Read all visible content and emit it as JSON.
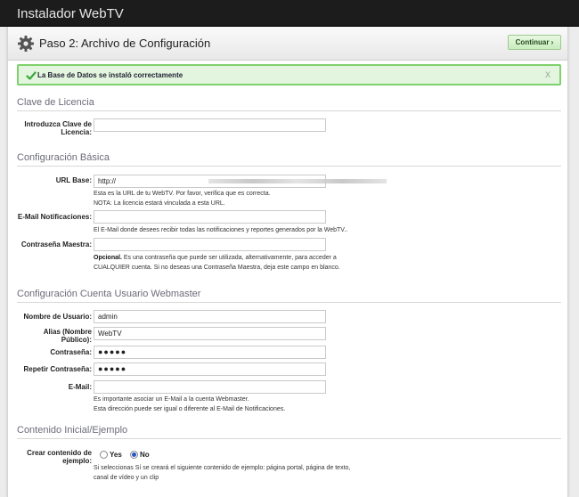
{
  "app": {
    "title": "Instalador WebTV"
  },
  "header": {
    "title": "Paso 2: Archivo de Configuración",
    "continue_label": "Continuar ›"
  },
  "alert": {
    "message": "La Base de Datos se instaló correctamente",
    "close": "X"
  },
  "license": {
    "section_title": "Clave de Licencia",
    "key_label": "Introduzca Clave de Licencia:",
    "key_value": ""
  },
  "basic": {
    "section_title": "Configuración Básica",
    "url_label": "URL Base:",
    "url_value": "http://",
    "url_help_1": "Esta es la URL de tu WebTV. Por favor, verifica que es correcta.",
    "url_help_2": "NOTA: La licencia estará vinculada a esta URL.",
    "email_label": "E-Mail Notificaciones:",
    "email_value": "",
    "email_help": "El E-Mail donde desees recibir todas las notificaciones y reportes generados por la WebTV..",
    "master_label": "Contraseña Maestra:",
    "master_value": "",
    "master_help_bold": "Opcional.",
    "master_help_1": " Es una contraseña que puede ser utilizada, alternativamente, para acceder a",
    "master_help_2": "CUALQUIER cuenta. Si no deseas una Contraseña Maestra, deja este campo en blanco."
  },
  "webmaster": {
    "section_title": "Configuración Cuenta Usuario Webmaster",
    "username_label": "Nombre de Usuario:",
    "username_value": "admin",
    "alias_label": "Alias (Nombre Público):",
    "alias_value": "WebTV",
    "password_label": "Contraseña:",
    "password_value": "●●●●●",
    "repeat_label": "Repetir Contraseña:",
    "repeat_value": "●●●●●",
    "email_label": "E-Mail:",
    "email_value": "",
    "email_help_1": "Es importante asociar un E-Mail a la cuenta Webmaster.",
    "email_help_2": "Esta dirección puede ser igual o diferente al E-Mail de Notificaciones."
  },
  "content": {
    "section_title": "Contenido Inicial/Ejemplo",
    "create_label": "Crear contenido de ejemplo:",
    "yes_label": "Yes",
    "no_label": "No",
    "selected": "No",
    "help_1": "Si seleccionas Sí se creará el siguiente contenido de ejemplo: página portal, página de texto,",
    "help_2": "canal de vídeo y un clip"
  },
  "colors": {
    "accent_green": "#7fd16d",
    "button_green": "#c9ecbd",
    "radio_blue": "#2357c5"
  }
}
